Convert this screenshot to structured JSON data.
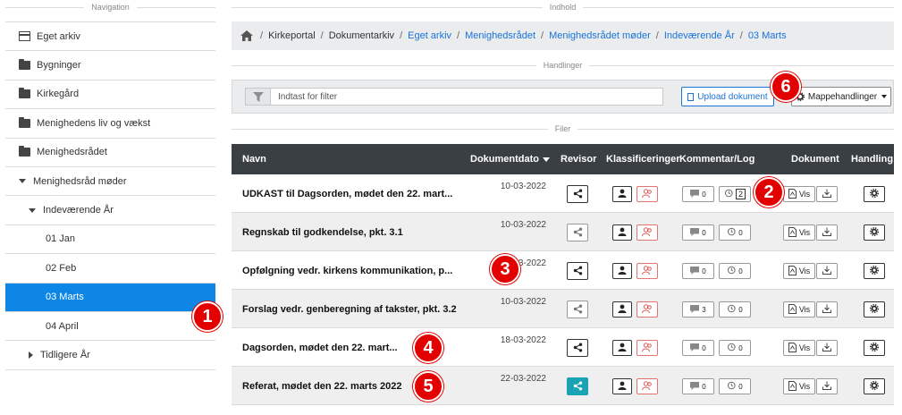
{
  "sections": {
    "navigation": "Navigation",
    "content": "Indhold",
    "actions": "Handlinger",
    "files": "Filer"
  },
  "nav": {
    "items": [
      {
        "label": "Eget arkiv",
        "icon": "archive-icon"
      },
      {
        "label": "Bygninger",
        "icon": "folder-icon"
      },
      {
        "label": "Kirkegård",
        "icon": "folder-icon"
      },
      {
        "label": "Menighedens liv og vækst",
        "icon": "folder-icon"
      },
      {
        "label": "Menighedsrådet",
        "icon": "folder-icon"
      },
      {
        "label": "Menighedsråd møder",
        "icon": "caret-down-icon"
      },
      {
        "label": "Indeværende År",
        "icon": "caret-down-icon"
      },
      {
        "label": "01 Jan"
      },
      {
        "label": "02 Feb"
      },
      {
        "label": "03 Marts",
        "active": true
      },
      {
        "label": "04 April"
      },
      {
        "label": "Tidligere År",
        "icon": "caret-right-icon"
      }
    ]
  },
  "breadcrumb": {
    "items": [
      {
        "label": "Kirkeportal"
      },
      {
        "label": "Dokumentarkiv"
      },
      {
        "label": "Eget arkiv"
      },
      {
        "label": "Menighedsrådet"
      },
      {
        "label": "Menighedsrådet møder"
      },
      {
        "label": "Indeværende År"
      },
      {
        "label": "03 Marts"
      }
    ]
  },
  "actions": {
    "filter_placeholder": "Indtast for filter",
    "upload_label": "Upload dokument",
    "folder_actions_label": "Mappehandlinger"
  },
  "table": {
    "headers": {
      "name": "Navn",
      "date": "Dokumentdato",
      "revisor": "Revisor",
      "classifications": "Klassificeringer",
      "comments": "Kommentar/Log",
      "document": "Dokument",
      "action": "Handling"
    },
    "view_label": "Vis",
    "rows": [
      {
        "name": "UDKAST til Dagsorden, mødet den 22. mart...",
        "date": "10-03-2022",
        "comments": "0",
        "log": "2"
      },
      {
        "name": "Regnskab til godkendelse, pkt. 3.1",
        "date": "10-03-2022",
        "comments": "0",
        "log": "0"
      },
      {
        "name": "Opfølgning vedr. kirkens kommunikation, p...",
        "date": "3-2022",
        "comments": "0",
        "log": "0"
      },
      {
        "name": "Forslag vedr. genberegning af takster, pkt. 3.2",
        "date": "10-03-2022",
        "comments": "3",
        "log": "0"
      },
      {
        "name": "Dagsorden, mødet den 22. mart...",
        "date": "18-03-2022",
        "comments": "0",
        "log": "0"
      },
      {
        "name": "Referat, mødet den 22. marts 2022",
        "date": "22-03-2022",
        "comments": "0",
        "log": "0"
      }
    ]
  },
  "callouts": [
    "1",
    "2",
    "3",
    "4",
    "5",
    "6"
  ],
  "colors": {
    "active_nav": "#0d86e6",
    "header_bg": "#3a3f44",
    "link": "#1a73d9",
    "callout": "#e20000",
    "teal": "#1aa3b5"
  }
}
